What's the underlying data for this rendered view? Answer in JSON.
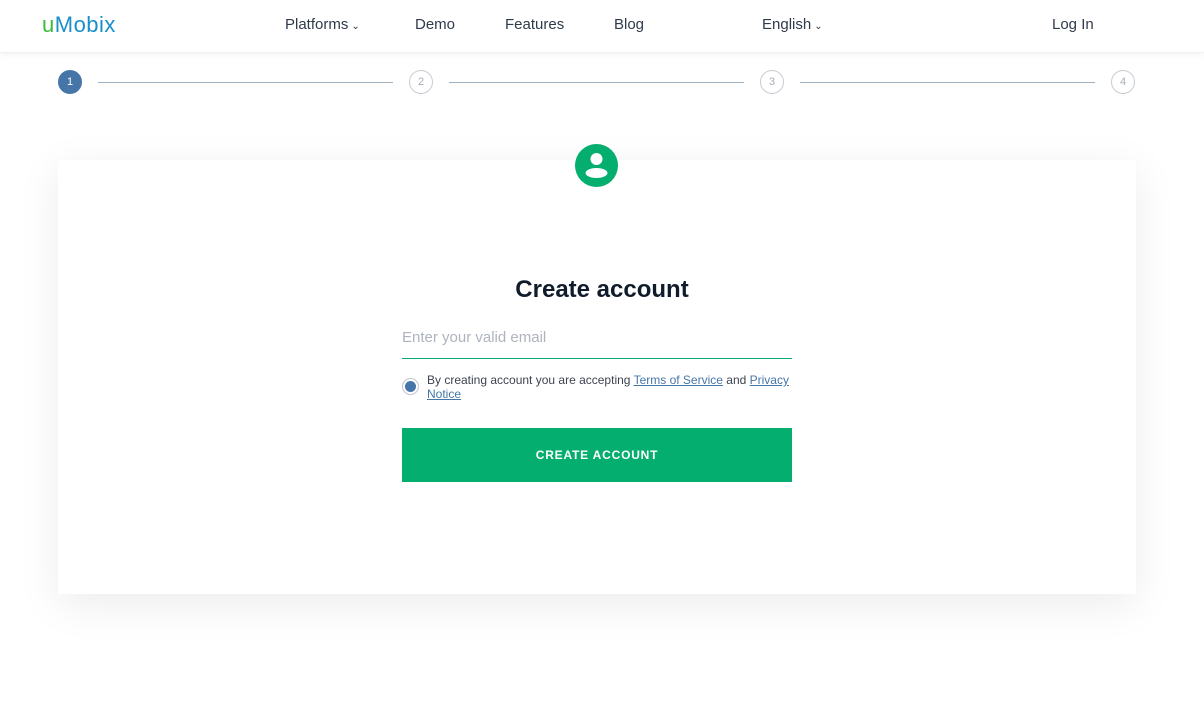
{
  "nav": {
    "logo_u": "u",
    "logo_rest": "Mobix",
    "platforms": "Platforms",
    "demo": "Demo",
    "features": "Features",
    "blog": "Blog",
    "language": "English",
    "login": "Log In"
  },
  "steps": [
    "1",
    "2",
    "3",
    "4"
  ],
  "form": {
    "title": "Create account",
    "email_placeholder": "Enter your valid email",
    "terms_prefix": "By creating account you are accepting ",
    "terms_link": "Terms of Service",
    "terms_and": " and ",
    "privacy_link": "Privacy Notice",
    "button": "CREATE ACCOUNT"
  },
  "colors": {
    "accent": "#04ae6e",
    "step_active": "#4676a8"
  }
}
